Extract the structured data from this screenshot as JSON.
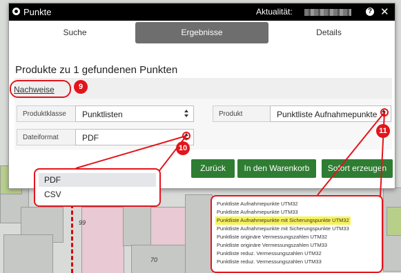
{
  "window": {
    "title": "Punkte",
    "aktualitaet_label": "Aktualität:",
    "help_icon": "help-icon",
    "close_icon": "close-icon",
    "close_glyph": "✕",
    "help_glyph": "?"
  },
  "tabs": [
    {
      "label": "Suche",
      "active": false
    },
    {
      "label": "Ergebnisse",
      "active": true
    },
    {
      "label": "Details",
      "active": false
    }
  ],
  "heading": "Produkte zu 1 gefundenen Punkten",
  "nachweise_link": "Nachweise",
  "form": {
    "produktklasse_label": "Produktklasse",
    "produktklasse_value": "Punktlisten",
    "produkt_label": "Produkt",
    "produkt_value": "Punktliste Aufnahmepunkte",
    "dateiformat_label": "Dateiformat",
    "dateiformat_value": "PDF"
  },
  "buttons": {
    "zurueck": "Zurück",
    "warenkorb": "In den Warenkorb",
    "erzeugen": "Sofort erzeugen"
  },
  "badges": [
    "9",
    "10",
    "11"
  ],
  "dateiformat_options": [
    "PDF",
    "CSV"
  ],
  "dateiformat_selected": "PDF",
  "produkt_options": [
    "Punktliste Aufnahmepunkte UTM32",
    "Punktliste Aufnahmepunkte UTM33",
    "Punktliste Aufnahmepunkte mit Sicherungspunkte UTM32",
    "Punktliste Aufnahmepunkte mit Sicherungspunkte UTM33",
    "Punktliste originäre Vermessungszahlen UTM32",
    "Punktliste originäre Vermessungszahlen UTM33",
    "Punktliste reduz. Vermessungszahlen UTM32",
    "Punktliste reduz. Vermessungszahlen UTM33"
  ],
  "produkt_highlighted": "Punktliste Aufnahmepunkte mit Sicherungspunkte UTM32",
  "map_labels": [
    "99",
    "70"
  ],
  "colors": {
    "accent_green": "#2e7d32",
    "callout_red": "#e3141b",
    "highlight_yellow": "#f7f25a",
    "titlebar": "#000000",
    "active_tab": "#6e6e6e"
  }
}
